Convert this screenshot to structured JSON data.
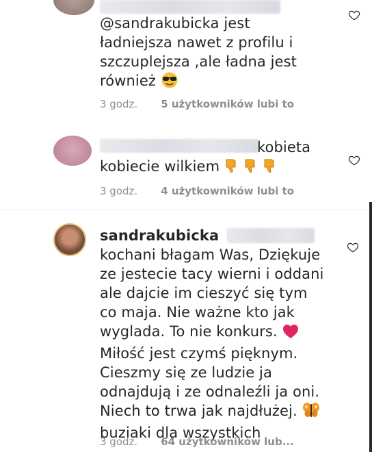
{
  "comments": [
    {
      "text": "@sandrakubicka jest ładniejsza nawet z profilu i szczuplejsza ,ale ładna jest również",
      "time": "3 godz.",
      "likes": "5 użytkowników lubi to",
      "emoji": "sunglasses-emoji"
    },
    {
      "text_after_blur": "kobieta",
      "text_line2": "kobiecie wilkiem",
      "time": "3 godz.",
      "likes": "4 użytkowników lubi to",
      "emoji": "thumbs-down-emoji"
    },
    {
      "username": "sandrakubicka",
      "lines": [
        "kochani błagam Was, Dziękuje",
        "ze jestecie tacy wierni i oddani",
        "ale dajcie im cieszyć się tym",
        "co maja. Nie ważne kto jak",
        "wyglada. To nie konkurs.",
        "Miłość jest czymś pięknym.",
        "Cieszmy się ze ludzie ja",
        "odnajdują i ze odnaleźli ja oni.",
        "Niech to trwa jak najdłużej.",
        "buziaki dla wszystkich"
      ],
      "time": "3 godz.",
      "likes": "64 użytkowników lub...",
      "verified_icon": "verified-badge-icon"
    }
  ],
  "colors": {
    "text": "#262626",
    "meta": "#8e8e8e",
    "verified": "#3897f0",
    "heart_emoji": "#e0245e"
  }
}
